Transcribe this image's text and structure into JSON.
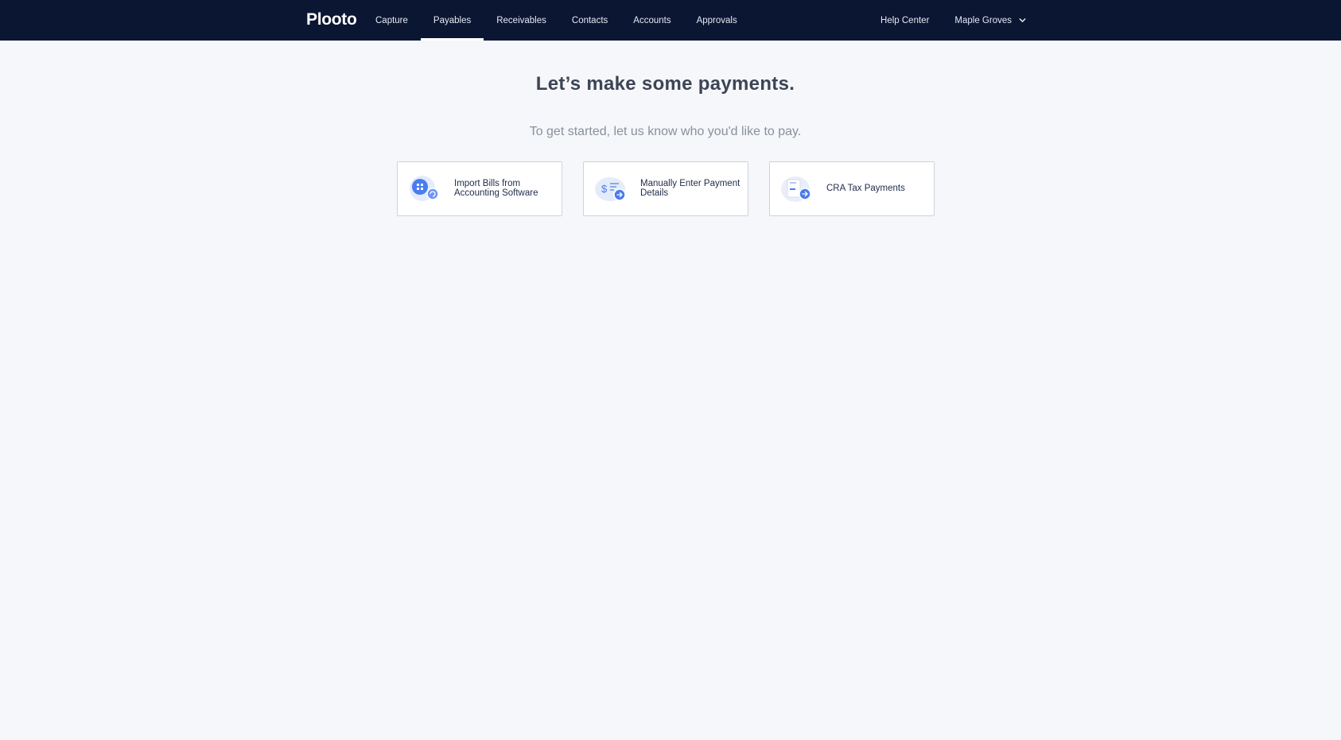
{
  "app": {
    "logo": "Plooto"
  },
  "nav": {
    "items": [
      {
        "label": "Capture"
      },
      {
        "label": "Payables"
      },
      {
        "label": "Receivables"
      },
      {
        "label": "Contacts"
      },
      {
        "label": "Accounts"
      },
      {
        "label": "Approvals"
      }
    ],
    "active": "Payables",
    "help_label": "Help Center",
    "account_label": "Maple Groves"
  },
  "main": {
    "headline": "Let’s make some payments.",
    "subheadline": "To get started, let us know who you'd like to pay.",
    "cards": [
      {
        "label": "Import Bills from Accounting Software",
        "icon": "import-bills-icon"
      },
      {
        "label": "Manually Enter Payment Details",
        "icon": "manual-payment-icon"
      },
      {
        "label": "CRA Tax Payments",
        "icon": "tax-payment-icon"
      }
    ]
  },
  "colors": {
    "topbar": "#0b1633",
    "background": "#f5f7fa",
    "accent": "#4a7cf0"
  }
}
